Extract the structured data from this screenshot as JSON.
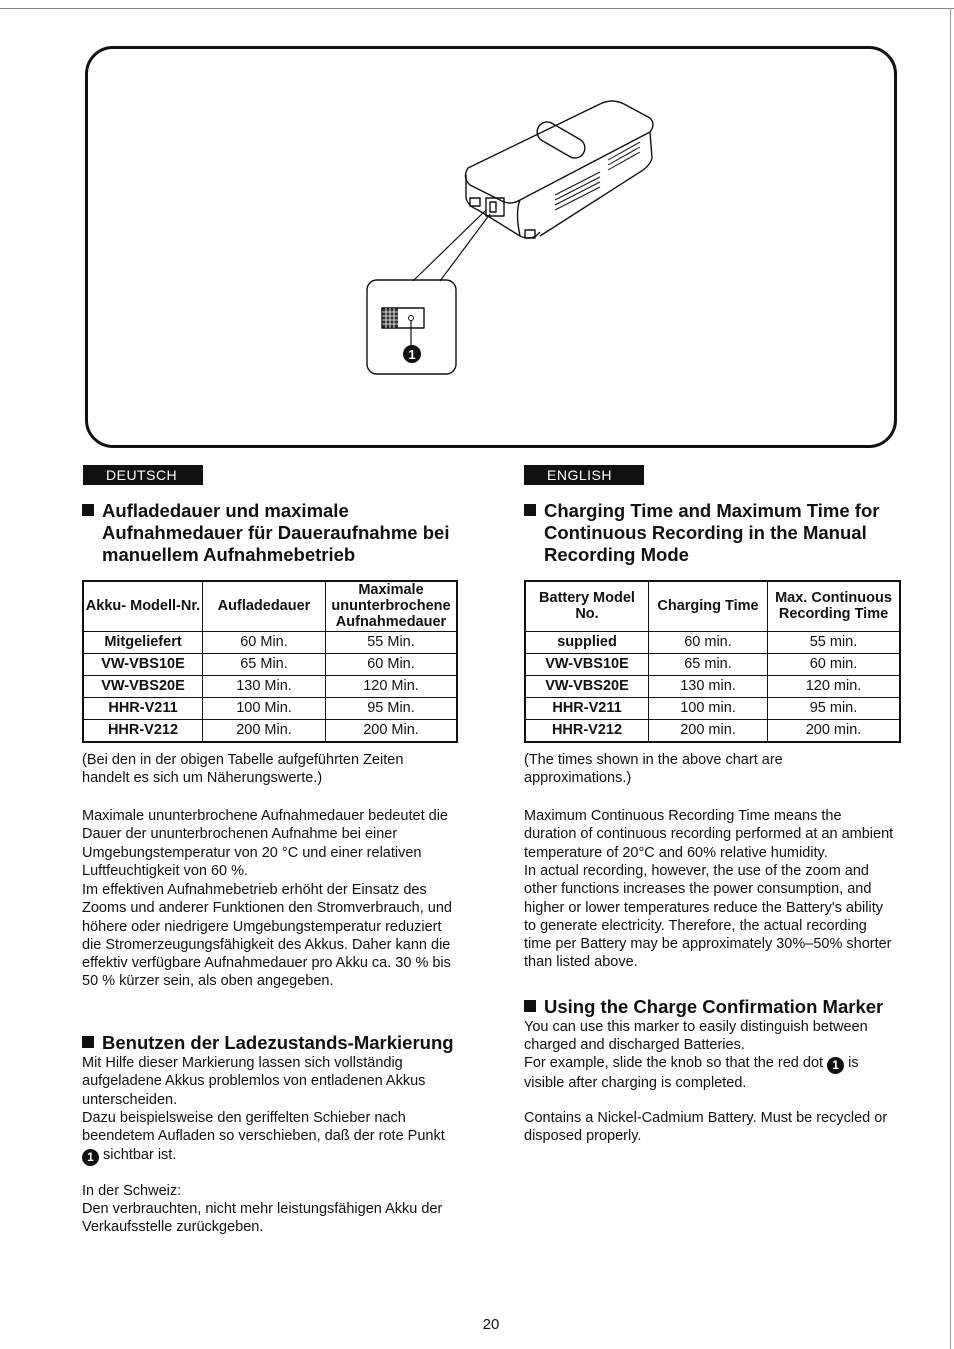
{
  "figure": {
    "callout_number": "1"
  },
  "german": {
    "lang_label": "DEUTSCH",
    "heading1_lines": [
      "Aufladedauer und maximale",
      "Aufnahmedauer für Daueraufnahme bei",
      "manuellem Aufnahmebetrieb"
    ],
    "table": {
      "headers": [
        "Akku- Modell-Nr.",
        "Aufladedauer",
        "Maximale ununterbrochene Aufnahmedauer"
      ],
      "rows": [
        [
          "Mitgeliefert",
          "60 Min.",
          "55 Min."
        ],
        [
          "VW-VBS10E",
          "65 Min.",
          "60 Min."
        ],
        [
          "VW-VBS20E",
          "130 Min.",
          "120 Min."
        ],
        [
          "HHR-V211",
          "100 Min.",
          "95 Min."
        ],
        [
          "HHR-V212",
          "200 Min.",
          "200 Min."
        ]
      ]
    },
    "note": "(Bei den in der obigen Tabelle aufgeführten Zeiten handelt es sich um Näherungswerte.)",
    "body1": "Maximale ununterbrochene Aufnahmedauer bedeutet die Dauer der ununterbrochenen Aufnahme bei einer Umgebungstemperatur von 20 °C und einer relativen Luftfeuchtigkeit von 60 %.",
    "body2": "Im effektiven Aufnahmebetrieb erhöht der Einsatz des Zooms und anderer Funktionen den Stromverbrauch, und höhere oder niedrigere Umgebungstemperatur reduziert die Stromerzeugungsfähigkeit des Akkus. Daher kann die effektiv verfügbare Aufnahmedauer pro Akku ca. 30 % bis 50 % kürzer sein, als oben angegeben.",
    "heading2": "Benutzen der Ladezustands-Markierung",
    "marker_text1": "Mit Hilfe dieser Markierung lassen sich vollständig aufgeladene Akkus problemlos von entladenen Akkus unterscheiden.",
    "marker_text2_a": "Dazu beispielsweise den geriffelten Schieber nach beendetem Aufladen so verschieben, daß der rote Punkt",
    "marker_text2_b": "sichtbar ist.",
    "swiss_label": "In der Schweiz:",
    "swiss_text": "Den verbrauchten, nicht mehr leistungsfähigen Akku der Verkaufsstelle zurückgeben."
  },
  "english": {
    "lang_label": "ENGLISH",
    "heading1_lines": [
      "Charging Time and Maximum Time for",
      "Continuous Recording in the Manual",
      "Recording Mode"
    ],
    "table": {
      "headers": [
        "Battery Model No.",
        "Charging Time",
        "Max. Continuous Recording Time"
      ],
      "rows": [
        [
          "supplied",
          "60 min.",
          "55 min."
        ],
        [
          "VW-VBS10E",
          "65 min.",
          "60 min."
        ],
        [
          "VW-VBS20E",
          "130 min.",
          "120 min."
        ],
        [
          "HHR-V211",
          "100 min.",
          "95 min."
        ],
        [
          "HHR-V212",
          "200 min.",
          "200 min."
        ]
      ]
    },
    "note": "(The times shown in the above chart are approximations.)",
    "body1": "Maximum Continuous Recording Time means the duration of continuous recording performed at an ambient temperature of 20°C and 60% relative humidity.",
    "body2": "In actual recording, however, the use of the zoom and other functions increases the power consumption, and higher or lower temperatures reduce the Battery's ability to generate electricity. Therefore, the actual recording time per Battery may be approximately 30%–50% shorter than listed above.",
    "heading2": "Using the Charge Confirmation Marker",
    "marker_text1": "You can use this marker to easily distinguish between charged and discharged Batteries.",
    "marker_text2_a": "For example, slide the knob so that the red dot",
    "marker_text2_b": "is visible after charging is completed.",
    "recycle_text": "Contains a Nickel-Cadmium Battery. Must be recycled or disposed properly."
  },
  "page_number": "20"
}
